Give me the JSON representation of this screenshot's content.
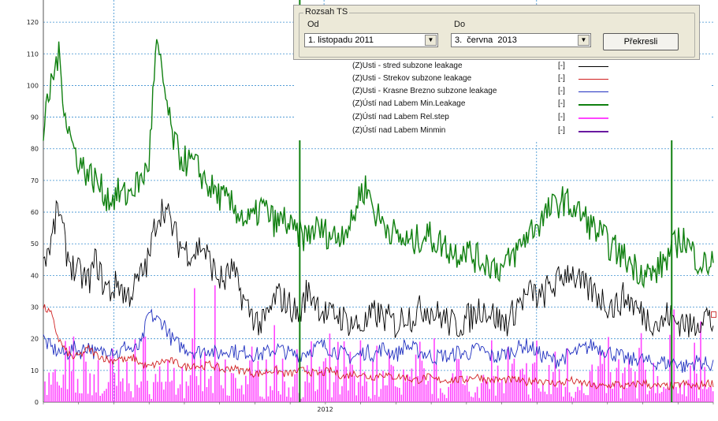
{
  "chart_data": {
    "type": "line",
    "title": "",
    "xlabel": "",
    "ylabel": "",
    "x_tick_labels": [
      "2012"
    ],
    "y_ticks": [
      0,
      10,
      20,
      30,
      40,
      50,
      60,
      70,
      80,
      90,
      100,
      110,
      120
    ],
    "ylim": [
      0,
      127
    ],
    "xlim": [
      "2011-11-01",
      "2013-06-03"
    ],
    "grid": true,
    "legend_placement": "top-right",
    "series": [
      {
        "name": "(Z)Usti - stred subzone leakage",
        "unit": "[-]",
        "color": "#000000",
        "type": "line",
        "values": [
          45,
          50,
          62,
          48,
          42,
          40,
          38,
          45,
          37,
          35,
          38,
          33,
          36,
          40,
          45,
          58,
          62,
          56,
          50,
          48,
          47,
          50,
          45,
          40,
          38,
          42,
          36,
          30,
          27,
          24,
          28,
          34,
          32,
          30,
          27,
          35,
          33,
          29,
          27,
          28,
          26,
          25,
          24,
          25,
          28,
          27,
          26,
          24,
          28,
          27,
          29,
          30,
          28,
          27,
          25,
          24,
          26,
          27,
          30,
          29,
          27,
          25,
          26,
          31,
          33,
          35,
          32,
          36,
          37,
          40,
          42,
          38,
          36,
          35,
          33,
          31,
          30,
          33,
          32,
          29,
          27,
          26,
          24,
          28,
          25,
          26,
          23,
          26,
          28,
          24
        ]
      },
      {
        "name": "(Z)Usti - Strekov subzone leakage",
        "unit": "[-]",
        "color": "#d02020",
        "type": "line",
        "values": [
          30,
          28,
          20,
          16,
          14,
          15,
          17,
          15,
          14,
          13,
          14,
          13,
          14,
          12,
          11,
          12,
          13,
          13,
          12,
          11,
          12,
          11,
          12,
          11,
          10,
          11,
          10,
          10,
          9,
          9,
          10,
          10,
          9,
          9,
          10,
          10,
          9,
          9,
          10,
          9,
          8,
          9,
          9,
          8,
          8,
          9,
          8,
          8,
          8,
          7,
          7,
          8,
          7,
          7,
          7,
          7,
          7,
          8,
          8,
          7,
          7,
          7,
          7,
          7,
          6,
          7,
          7,
          6,
          6,
          6,
          7,
          6,
          6,
          5,
          5,
          5,
          6,
          5,
          5,
          6,
          6,
          5,
          5,
          5,
          5,
          6,
          5,
          5,
          6,
          6
        ]
      },
      {
        "name": "(Z)Usti - Krasne Brezno subzone leakage",
        "unit": "[-]",
        "color": "#2030c0",
        "type": "line",
        "values": [
          20,
          17,
          16,
          15,
          17,
          16,
          18,
          15,
          16,
          17,
          15,
          18,
          16,
          18,
          28,
          26,
          25,
          20,
          18,
          17,
          16,
          16,
          17,
          15,
          16,
          17,
          15,
          16,
          15,
          15,
          16,
          17,
          16,
          15,
          15,
          16,
          17,
          18,
          17,
          16,
          15,
          14,
          15,
          16,
          15,
          17,
          16,
          15,
          18,
          17,
          16,
          15,
          14,
          15,
          14,
          16,
          15,
          16,
          17,
          15,
          14,
          15,
          16,
          17,
          18,
          17,
          15,
          14,
          13,
          14,
          15,
          16,
          17,
          18,
          17,
          16,
          15,
          14,
          13,
          14,
          13,
          12,
          13,
          12,
          13,
          11,
          12,
          13,
          12,
          12
        ]
      },
      {
        "name": "(Z)Ústí nad Labem Min.Leakage",
        "unit": "[-]",
        "color": "#108010",
        "type": "line",
        "values": [
          85,
          100,
          110,
          90,
          80,
          75,
          72,
          70,
          66,
          64,
          66,
          65,
          68,
          70,
          75,
          113,
          100,
          85,
          78,
          76,
          75,
          72,
          68,
          66,
          64,
          62,
          60,
          57,
          58,
          62,
          59,
          56,
          58,
          54,
          53,
          52,
          55,
          54,
          53,
          52,
          55,
          56,
          66,
          68,
          60,
          57,
          55,
          52,
          51,
          50,
          52,
          53,
          51,
          50,
          48,
          47,
          49,
          46,
          45,
          44,
          43,
          42,
          45,
          48,
          52,
          55,
          57,
          60,
          62,
          64,
          62,
          60,
          58,
          55,
          53,
          50,
          48,
          46,
          44,
          42,
          41,
          40,
          43,
          46,
          50,
          52,
          48,
          45,
          43,
          45
        ]
      },
      {
        "name": "(Z)Ústí nad Labem Rel.step",
        "unit": "[-]",
        "color": "#ff44ff",
        "type": "line",
        "values": []
      },
      {
        "name": "(Z)Ústí nad Labem Minmin",
        "unit": "[-]",
        "color": "#6a1aa0",
        "type": "line",
        "values": []
      }
    ],
    "spikes": [
      {
        "series": "(Z)Ústí nad Labem Min.Leakage",
        "color": "#108010",
        "value": 127
      },
      {
        "series": "(Z)Ústí nad Labem Min.Leakage",
        "color": "#108010",
        "value": 84
      }
    ]
  },
  "ts_panel": {
    "title": "Rozsah TS",
    "from_label": "Od",
    "to_label": "Do",
    "from_value": "1. listopadu 2011",
    "to_value": "3.  června  2013",
    "dropdown_arrow": "▼",
    "redraw_label": "Překresli"
  }
}
